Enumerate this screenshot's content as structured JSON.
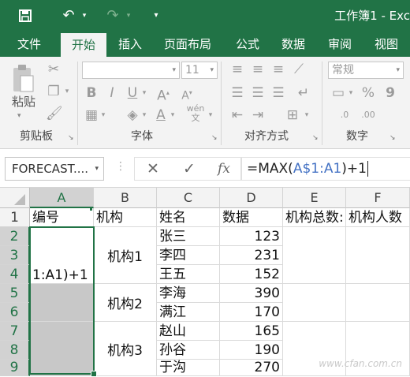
{
  "titlebar": {
    "save_icon": "save-icon",
    "undo_icon": "undo-icon",
    "redo_icon": "redo-icon",
    "customize_icon": "customize-qat-icon",
    "document_title": "工作簿1 - Exc"
  },
  "tabs": [
    "文件",
    "开始",
    "插入",
    "页面布局",
    "公式",
    "数据",
    "审阅",
    "视图"
  ],
  "active_tab": "开始",
  "ribbon": {
    "clipboard": {
      "paste_label": "粘贴",
      "group_label": "剪贴板"
    },
    "font": {
      "font_size": "11",
      "bold": "B",
      "italic": "I",
      "underline": "U",
      "group_label": "字体"
    },
    "alignment": {
      "group_label": "对齐方式"
    },
    "number": {
      "format": "常规",
      "percent": "%",
      "comma": "9",
      "group_label": "数字"
    }
  },
  "formula_bar": {
    "name_box": "FORECAST....",
    "cancel": "✕",
    "enter": "✓",
    "fx": "fx",
    "formula_prefix": "=MAX(",
    "formula_ref": "A$1:A1",
    "formula_suffix": ")+1"
  },
  "sheet": {
    "columns": [
      "A",
      "B",
      "C",
      "D",
      "E",
      "F"
    ],
    "rows": [
      "1",
      "2",
      "3",
      "4",
      "5",
      "6",
      "7",
      "8",
      "9"
    ],
    "header_cells": [
      "编号",
      "机构",
      "姓名",
      "数据",
      "机构总数:",
      "机构人数"
    ],
    "a_edit_text": "1:A1)+1",
    "groups": [
      "机构1",
      "机构2",
      "机构3"
    ],
    "names": [
      "张三",
      "李四",
      "王五",
      "李海",
      "满江",
      "赵山",
      "孙谷",
      "于沟"
    ],
    "values": [
      "123",
      "231",
      "152",
      "390",
      "170",
      "165",
      "190",
      "270"
    ]
  },
  "watermark": "www.cfan.com.cn"
}
